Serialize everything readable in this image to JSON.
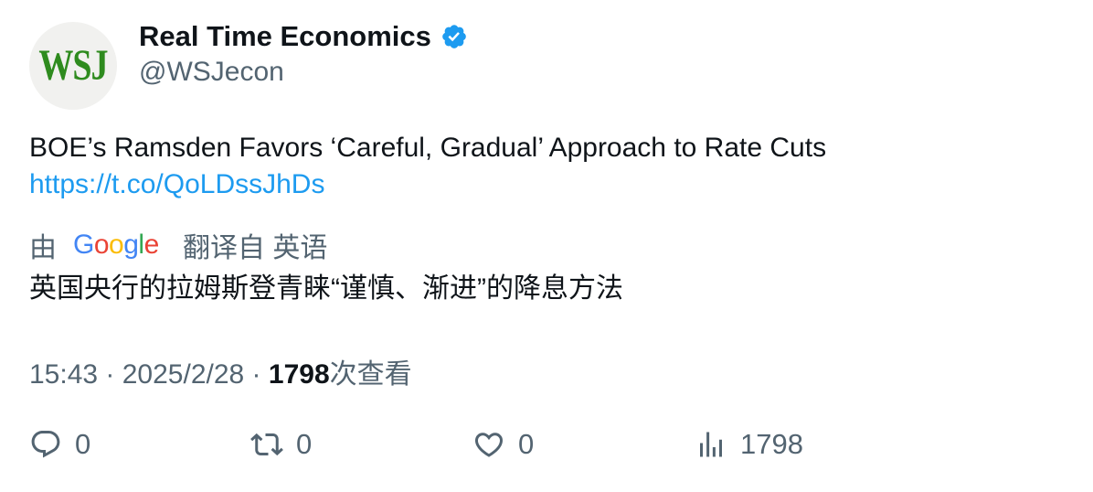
{
  "author": {
    "avatar_text": "WSJ",
    "display_name": "Real Time Economics",
    "handle": "@WSJecon",
    "verified_icon": "verified-badge-icon"
  },
  "tweet": {
    "text": "BOE’s Ramsden Favors ‘Careful, Gradual’ Approach to Rate Cuts",
    "link": "https://t.co/QoLDssJhDs"
  },
  "translation": {
    "by_label": "由",
    "provider": "Google",
    "from_label": "翻译自 英语",
    "text": "英国央行的拉姆斯登青睐“谨慎、渐进”的降息方法"
  },
  "meta": {
    "time": "15:43",
    "separator": " · ",
    "date": "2025/2/28",
    "views_count": "1798",
    "views_label": "次查看"
  },
  "actions": {
    "reply": {
      "icon": "reply-icon",
      "count": "0"
    },
    "retweet": {
      "icon": "retweet-icon",
      "count": "0"
    },
    "like": {
      "icon": "heart-icon",
      "count": "0"
    },
    "views": {
      "icon": "analytics-icon",
      "count": "1798"
    }
  },
  "colors": {
    "primary_text": "#0f1419",
    "secondary_text": "#536471",
    "link": "#1d9bf0",
    "verified": "#1d9bf0",
    "wsj_green": "#2e8b1e"
  }
}
